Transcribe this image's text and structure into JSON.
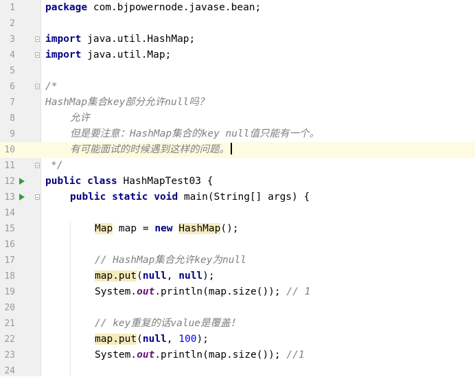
{
  "line_numbers": [
    "1",
    "2",
    "3",
    "4",
    "5",
    "6",
    "7",
    "8",
    "9",
    "10",
    "11",
    "12",
    "13",
    "14",
    "15",
    "16",
    "17",
    "18",
    "19",
    "20",
    "21",
    "22",
    "23",
    "24"
  ],
  "l1": {
    "kw": "package",
    "rest": " com.bjpowernode.javase.bean;"
  },
  "l3": {
    "kw": "import",
    "rest": " java.util.HashMap;"
  },
  "l4": {
    "kw": "import",
    "rest": " java.util.Map;"
  },
  "l6": {
    "text": "/*"
  },
  "l7": {
    "text": "HashMap集合key部分允许null吗？"
  },
  "l8": {
    "text": "允许"
  },
  "l9": {
    "text": "但是要注意：HashMap集合的key null值只能有一个。"
  },
  "l10": {
    "text": "有可能面试的时候遇到这样的问题。"
  },
  "l11": {
    "text": "*/"
  },
  "l12": {
    "kw1": "public",
    "kw2": "class",
    "rest": " HashMapTest03 {"
  },
  "l13": {
    "kw1": "public",
    "kw2": "static",
    "kw3": "void",
    "rest": " main(String[] args) {"
  },
  "l15": {
    "type": "Map",
    "mid": " map = ",
    "kw": "new",
    "cls": "HashMap",
    "end": "();"
  },
  "l17": {
    "text": "// HashMap集合允许key为null"
  },
  "l18": {
    "call": "map.put",
    "open": "(",
    "a1": "null",
    "sep": ", ",
    "a2": "null",
    "close": ");"
  },
  "l19": {
    "pre": "System.",
    "field": "out",
    "post": ".println(map.size()); ",
    "comment": "// 1"
  },
  "l21": {
    "text": "// key重复的话value是覆盖！"
  },
  "l22": {
    "call": "map.put",
    "open": "(",
    "a1": "null",
    "sep": ", ",
    "num": "100",
    "close": ");"
  },
  "l23": {
    "pre": "System.",
    "field": "out",
    "post": ".println(map.size()); ",
    "comment": "//1"
  }
}
